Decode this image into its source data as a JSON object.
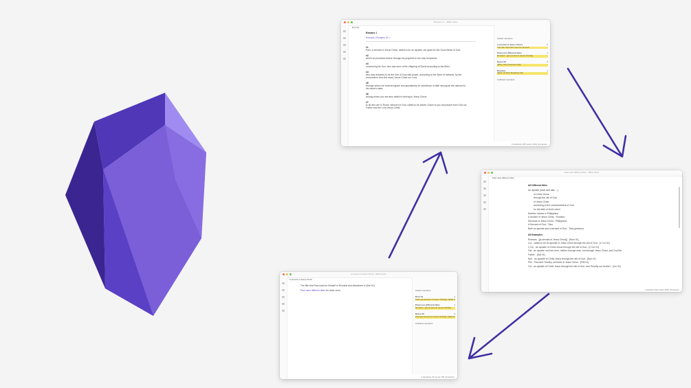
{
  "window1": {
    "title": "Romans 1.1 – Bible Notes",
    "tab": "Rom 01",
    "heading": "Romans 1",
    "nav": "Romans | Romans 02 >",
    "verses": [
      {
        "n": "v1",
        "text": "Paul, a servant of Jesus Christ, called to be an apostle, set apart for the Good News of God,"
      },
      {
        "n": "v2",
        "text": "which he promised before through his prophets in the holy Scriptures,"
      },
      {
        "n": "v3",
        "text": "concerning his Son, who was born of the offspring of David according to the flesh,"
      },
      {
        "n": "v4",
        "text": "who was declared to be the Son of God with power, according to the Spirit of holiness, by the"
      },
      {
        "n": "v4b",
        "text": "resurrection from the dead, Jesus Christ our Lord,"
      },
      {
        "n": "v5",
        "text": "through whom we received grace and apostleship for obedience of faith among all the nations for"
      },
      {
        "n": "v5b",
        "text": "his name's sake;"
      },
      {
        "n": "v6",
        "text": "among whom you are also called to belong to Jesus Christ;"
      },
      {
        "n": "v7",
        "text": "to all who are in Rome, beloved of God, called to be saints: Grace to you and peace from God our"
      },
      {
        "n": "v7b",
        "text": "Father and the Lord Jesus Christ."
      }
    ],
    "side_title": "Linked mentions",
    "side_items": [
      {
        "h": "a servant of Jesus Christ",
        "c": "3",
        "body": "The title that Paul uses for himself"
      },
      {
        "h": "Paul uses different titles",
        "c": "1",
        "body": "Romans - [[a servant of Jesus Christ]]"
      },
      {
        "h": "Notes 03",
        "c": "3",
        "body": "[[Rom 01v1 Romans 01]]"
      },
      {
        "h": "Romans",
        "c": "1",
        "body": "[[Rom 01 Bed Reading 10]]"
      }
    ],
    "side_footer": "Unlinked mentions",
    "status": "0 backlinks   180 words   1000 characters"
  },
  "window2": {
    "title": "Paul uses different titles – Bible Notes",
    "tab": "Paul uses different titles",
    "heading": "All Different titles",
    "bullets": [
      "An apostle (have and also ...)",
      "of Christ Jesus",
      "through the will of God",
      "of Jesus Christ",
      "according to the commandment of God",
      "for the faith of God's elect",
      "Number names in Philippians",
      "A servant of Jesus Christ - Romans",
      "Servants of Jesus Christ - Philippians",
      "A Servant of God - Titus",
      "Both an apostle and a servant of God - Titus (preface)"
    ],
    "heading2": "All Examples",
    "examples": [
      "Romans - [[a servant of Jesus Christ]] - [Rom 01]",
      "Cor - called to be an apostle of Jesus Christ through the will of God - [1 Cor 01]",
      "2 Cor - an apostle of Christ Jesus through the will of God - [2 Cor 01]",
      "Gal - an apostle not from men, neither through man, but through Jesus Christ, and God the",
      "Father - [Gal 01]",
      "Eph - an apostle of Christ Jesus through the will of God - [Eph 01]",
      "Phil - Paul and Timothy, servants of Jesus Christ - [Phil 01]",
      "Col - an apostle of Christ Jesus through the will of God, and Timothy our brother - [Col 01]"
    ],
    "status": "1 backlink   340 words   2000 characters"
  },
  "window3": {
    "title": "a servant of Jesus Christ – Bible Notes",
    "tab": "a servant of Jesus Christ",
    "line1": "The title that Paul uses for himself in Romans and elsewhere in [Gal 01].",
    "line2_link": "Paul uses different titles",
    "line2_rest": "for other ones.",
    "side_title": "Linked mentions",
    "side_items": [
      {
        "h": "Rom 01",
        "c": "1",
        "body": "Paul, [[a servant of Jesus Christ]], called to be an apostle"
      },
      {
        "h": "Paul uses different titles",
        "c": "1",
        "body": "Romans - [[a servant of Jesus Christ]]"
      },
      {
        "h": "Notes 03",
        "c": "3",
        "body": "Paul [[a servant of Jesus Christ]], called to be an apostle"
      }
    ],
    "side_footer": "Unlinked mentions",
    "status": "2 backlinks   25 words   150 characters"
  }
}
